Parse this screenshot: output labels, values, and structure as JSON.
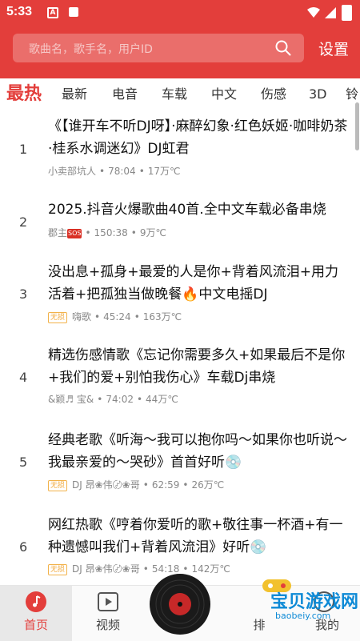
{
  "status": {
    "time": "5:33",
    "notif_a": "A"
  },
  "header": {
    "search_placeholder": "歌曲名，歌手名，用户ID",
    "settings_label": "设置"
  },
  "tabs": [
    "最热",
    "最新",
    "电音",
    "车载",
    "中文",
    "伤感",
    "3D",
    "铃"
  ],
  "songs": [
    {
      "index": "1",
      "title": "《【谁开车不听DJ呀】·麻醉幻象·红色妖姬·咖啡奶茶·桂系水调迷幻》DJ虹君",
      "author": "小卖部坑人",
      "duration": "78:04",
      "plays": "17万℃",
      "badge": ""
    },
    {
      "index": "2",
      "title": "2025.抖音火爆歌曲40首.全中文车载必备串烧",
      "author": "郡主",
      "author_badge": "SOS",
      "duration": "150:38",
      "plays": "9万℃",
      "badge": ""
    },
    {
      "index": "3",
      "title": "没出息+孤身+最爱的人是你+背着风流泪+用力活着+把孤独当做晚餐🔥中文电摇DJ",
      "author": "嗨歌",
      "duration": "45:24",
      "plays": "163万℃",
      "badge": "无损"
    },
    {
      "index": "4",
      "title": "精选伤感情歌《忘记你需要多久+如果最后不是你+我们的爱+别怕我伤心》车载Dj串烧",
      "author": "&颖♬ 宝&",
      "duration": "74:02",
      "plays": "44万℃",
      "badge": ""
    },
    {
      "index": "5",
      "title": "经典老歌《听海～我可以抱你吗～如果你也听说～我最亲爱的～哭砂》首首好听💿",
      "author": "DJ 昂❀伟〄❀哥",
      "duration": "62:59",
      "plays": "26万℃",
      "badge": "无损"
    },
    {
      "index": "6",
      "title": "网红热歌《哼着你爱听的歌+敬往事一杯酒+有一种遗憾叫我们+背着风流泪》好听💿",
      "author": "DJ 昂❀伟〄❀哥",
      "duration": "54:18",
      "plays": "142万℃",
      "badge": "无损"
    }
  ],
  "bottom_nav": [
    {
      "label": "首页",
      "icon": "music-note-icon"
    },
    {
      "label": "视频",
      "icon": "play-icon"
    },
    {
      "label": "",
      "icon": "vinyl-disc-icon"
    },
    {
      "label": "排",
      "icon": "chart-icon"
    },
    {
      "label": "我的",
      "icon": "user-icon"
    }
  ],
  "watermark": {
    "text": "宝贝游戏网",
    "url_text": "baobeiy.com"
  },
  "colors": {
    "accent": "#e33e3b",
    "badge": "#f2a93b",
    "watermark": "#0e8ad6"
  }
}
